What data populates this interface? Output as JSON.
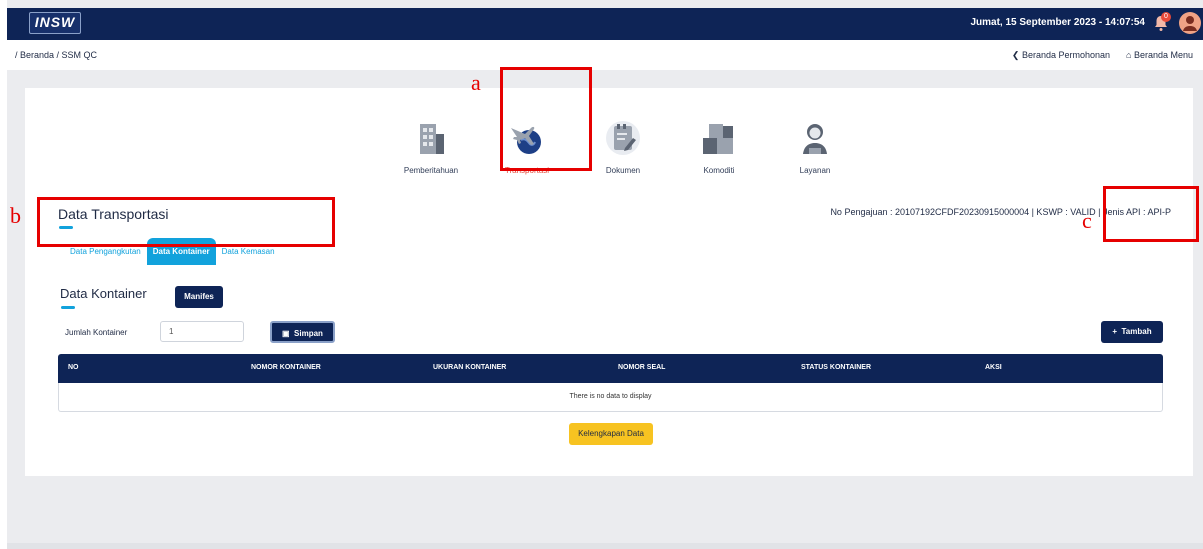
{
  "header": {
    "logo_text": "INSW",
    "datetime": "Jumat, 15 September 2023 - 14:07:54",
    "notification_count": "0",
    "colors": {
      "navy": "#0e2456",
      "accent": "#12a2dc",
      "yellow": "#f7c321",
      "red": "#e84a3a"
    }
  },
  "subbar": {
    "breadcrumb": "/ Beranda / SSM QC",
    "link_permohonan": "❮ Beranda Permohonan",
    "link_menu": "⌂ Beranda Menu"
  },
  "steps": [
    {
      "label": "Pemberitahuan",
      "icon": "building-icon"
    },
    {
      "label": "Transportasi",
      "icon": "plane-globe-icon"
    },
    {
      "label": "Dokumen",
      "icon": "document-icon"
    },
    {
      "label": "Komoditi",
      "icon": "boxes-icon"
    },
    {
      "label": "Layanan",
      "icon": "customer-service-icon"
    }
  ],
  "section": {
    "title": "Data Transportasi",
    "pengajuan": "No Pengajuan : 20107192CFDF20230915000004 | KSWP : VALID | Jenis API : API-P"
  },
  "tabs": [
    {
      "label": "Data Pengangkutan",
      "active": false
    },
    {
      "label": "Data Kontainer",
      "active": true
    },
    {
      "label": "Data Kemasan",
      "active": false
    }
  ],
  "kontainer": {
    "title": "Data Kontainer",
    "manifes_label": "Manifes",
    "jumlah_label": "Jumlah Kontainer",
    "jumlah_value": "1",
    "simpan_label": "Simpan",
    "tambah_label": "Tambah"
  },
  "table": {
    "columns": [
      "NO",
      "NOMOR KONTAINER",
      "UKURAN KONTAINER",
      "NOMOR SEAL",
      "STATUS KONTAINER",
      "AKSI"
    ],
    "empty_text": "There is no data to display"
  },
  "kelengkapan_label": "Kelengkapan Data",
  "annotations": {
    "a": "a",
    "b": "b",
    "c": "c"
  }
}
